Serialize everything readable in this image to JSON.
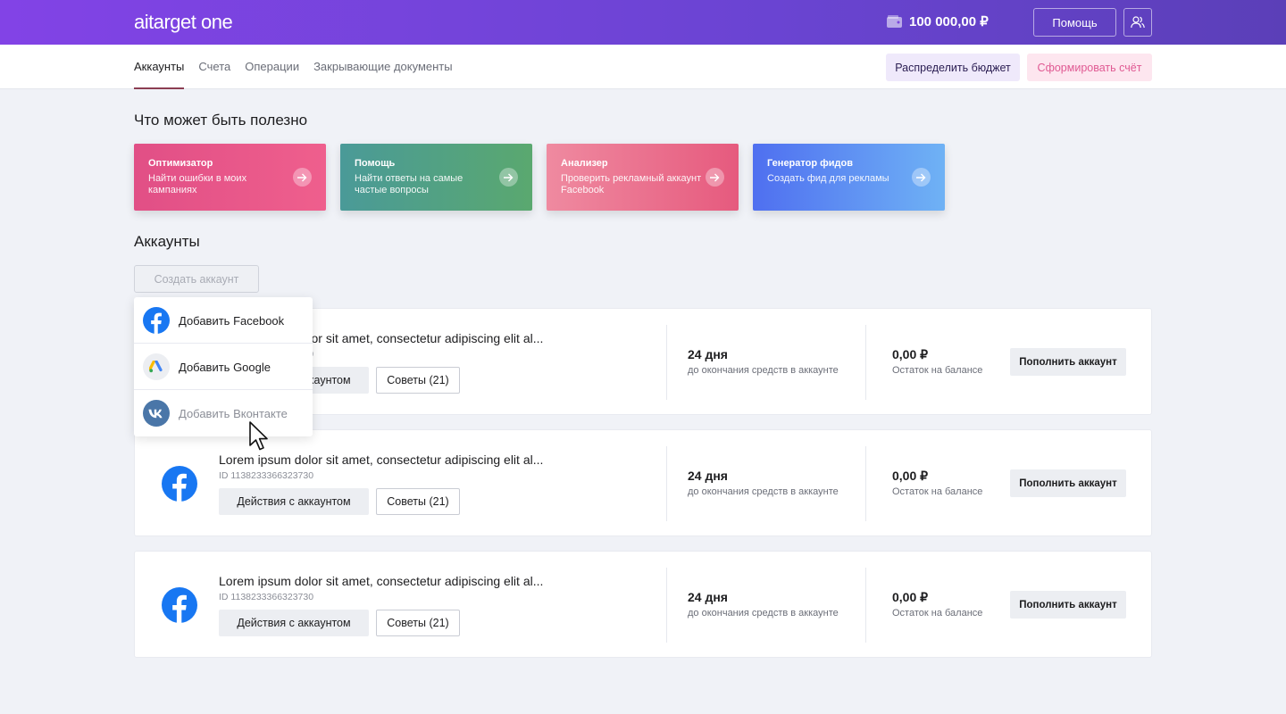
{
  "header": {
    "logo": "aitarget one",
    "balance": "100 000,00 ₽",
    "help_label": "Помощь"
  },
  "nav": {
    "tabs": [
      "Аккаунты",
      "Счета",
      "Операции",
      "Закрывающие документы"
    ],
    "active_tab": "Аккаунты",
    "budget_label": "Распределить бюджет",
    "invoice_label": "Сформировать счёт"
  },
  "useful": {
    "title": "Что может быть полезно",
    "cards": [
      {
        "title": "Оптимизатор",
        "desc": "Найти ошибки в моих кампаниях"
      },
      {
        "title": "Помощь",
        "desc": "Найти ответы на самые частые вопросы"
      },
      {
        "title": "Анализер",
        "desc": "Проверить рекламный аккаунт Facebook"
      },
      {
        "title": "Генератор фидов",
        "desc": "Создать фид для рекламы"
      }
    ]
  },
  "accounts": {
    "title": "Аккаунты",
    "create_label": "Создать аккаунт",
    "rows": [
      {
        "name": "Lorem ipsum dolor sit amet, consectetur adipiscing elit  al...",
        "id": "ID 1138233366323730",
        "actions_label": "Действия с аккаунтом",
        "tips_label": "Советы (21)",
        "days": "24 дня",
        "days_label": "до окончания средств в аккаунте",
        "balance": "0,00 ₽",
        "balance_label": "Остаток на балансе",
        "topup_label": "Пополнить аккаунт"
      },
      {
        "name": "Lorem ipsum dolor sit amet, consectetur adipiscing elit  al...",
        "id": "ID 1138233366323730",
        "actions_label": "Действия с аккаунтом",
        "tips_label": "Советы (21)",
        "days": "24 дня",
        "days_label": "до окончания средств в аккаунте",
        "balance": "0,00 ₽",
        "balance_label": "Остаток на балансе",
        "topup_label": "Пополнить аккаунт"
      },
      {
        "name": "Lorem ipsum dolor sit amet, consectetur adipiscing elit  al...",
        "id": "ID 1138233366323730",
        "actions_label": "Действия с аккаунтом",
        "tips_label": "Советы (21)",
        "days": "24 дня",
        "days_label": "до окончания средств в аккаунте",
        "balance": "0,00 ₽",
        "balance_label": "Остаток на балансе",
        "topup_label": "Пополнить аккаунт"
      }
    ]
  },
  "dropdown": {
    "items": [
      {
        "label": "Добавить Facebook",
        "icon": "facebook-icon"
      },
      {
        "label": "Добавить Google",
        "icon": "google-ads-icon"
      },
      {
        "label": "Добавить Вконтакте",
        "icon": "vk-icon"
      }
    ]
  },
  "colors": {
    "header_gradient_start": "#8243e6",
    "header_gradient_end": "#5b3fb8",
    "facebook": "#1877f2",
    "vk": "#4a76a8"
  }
}
